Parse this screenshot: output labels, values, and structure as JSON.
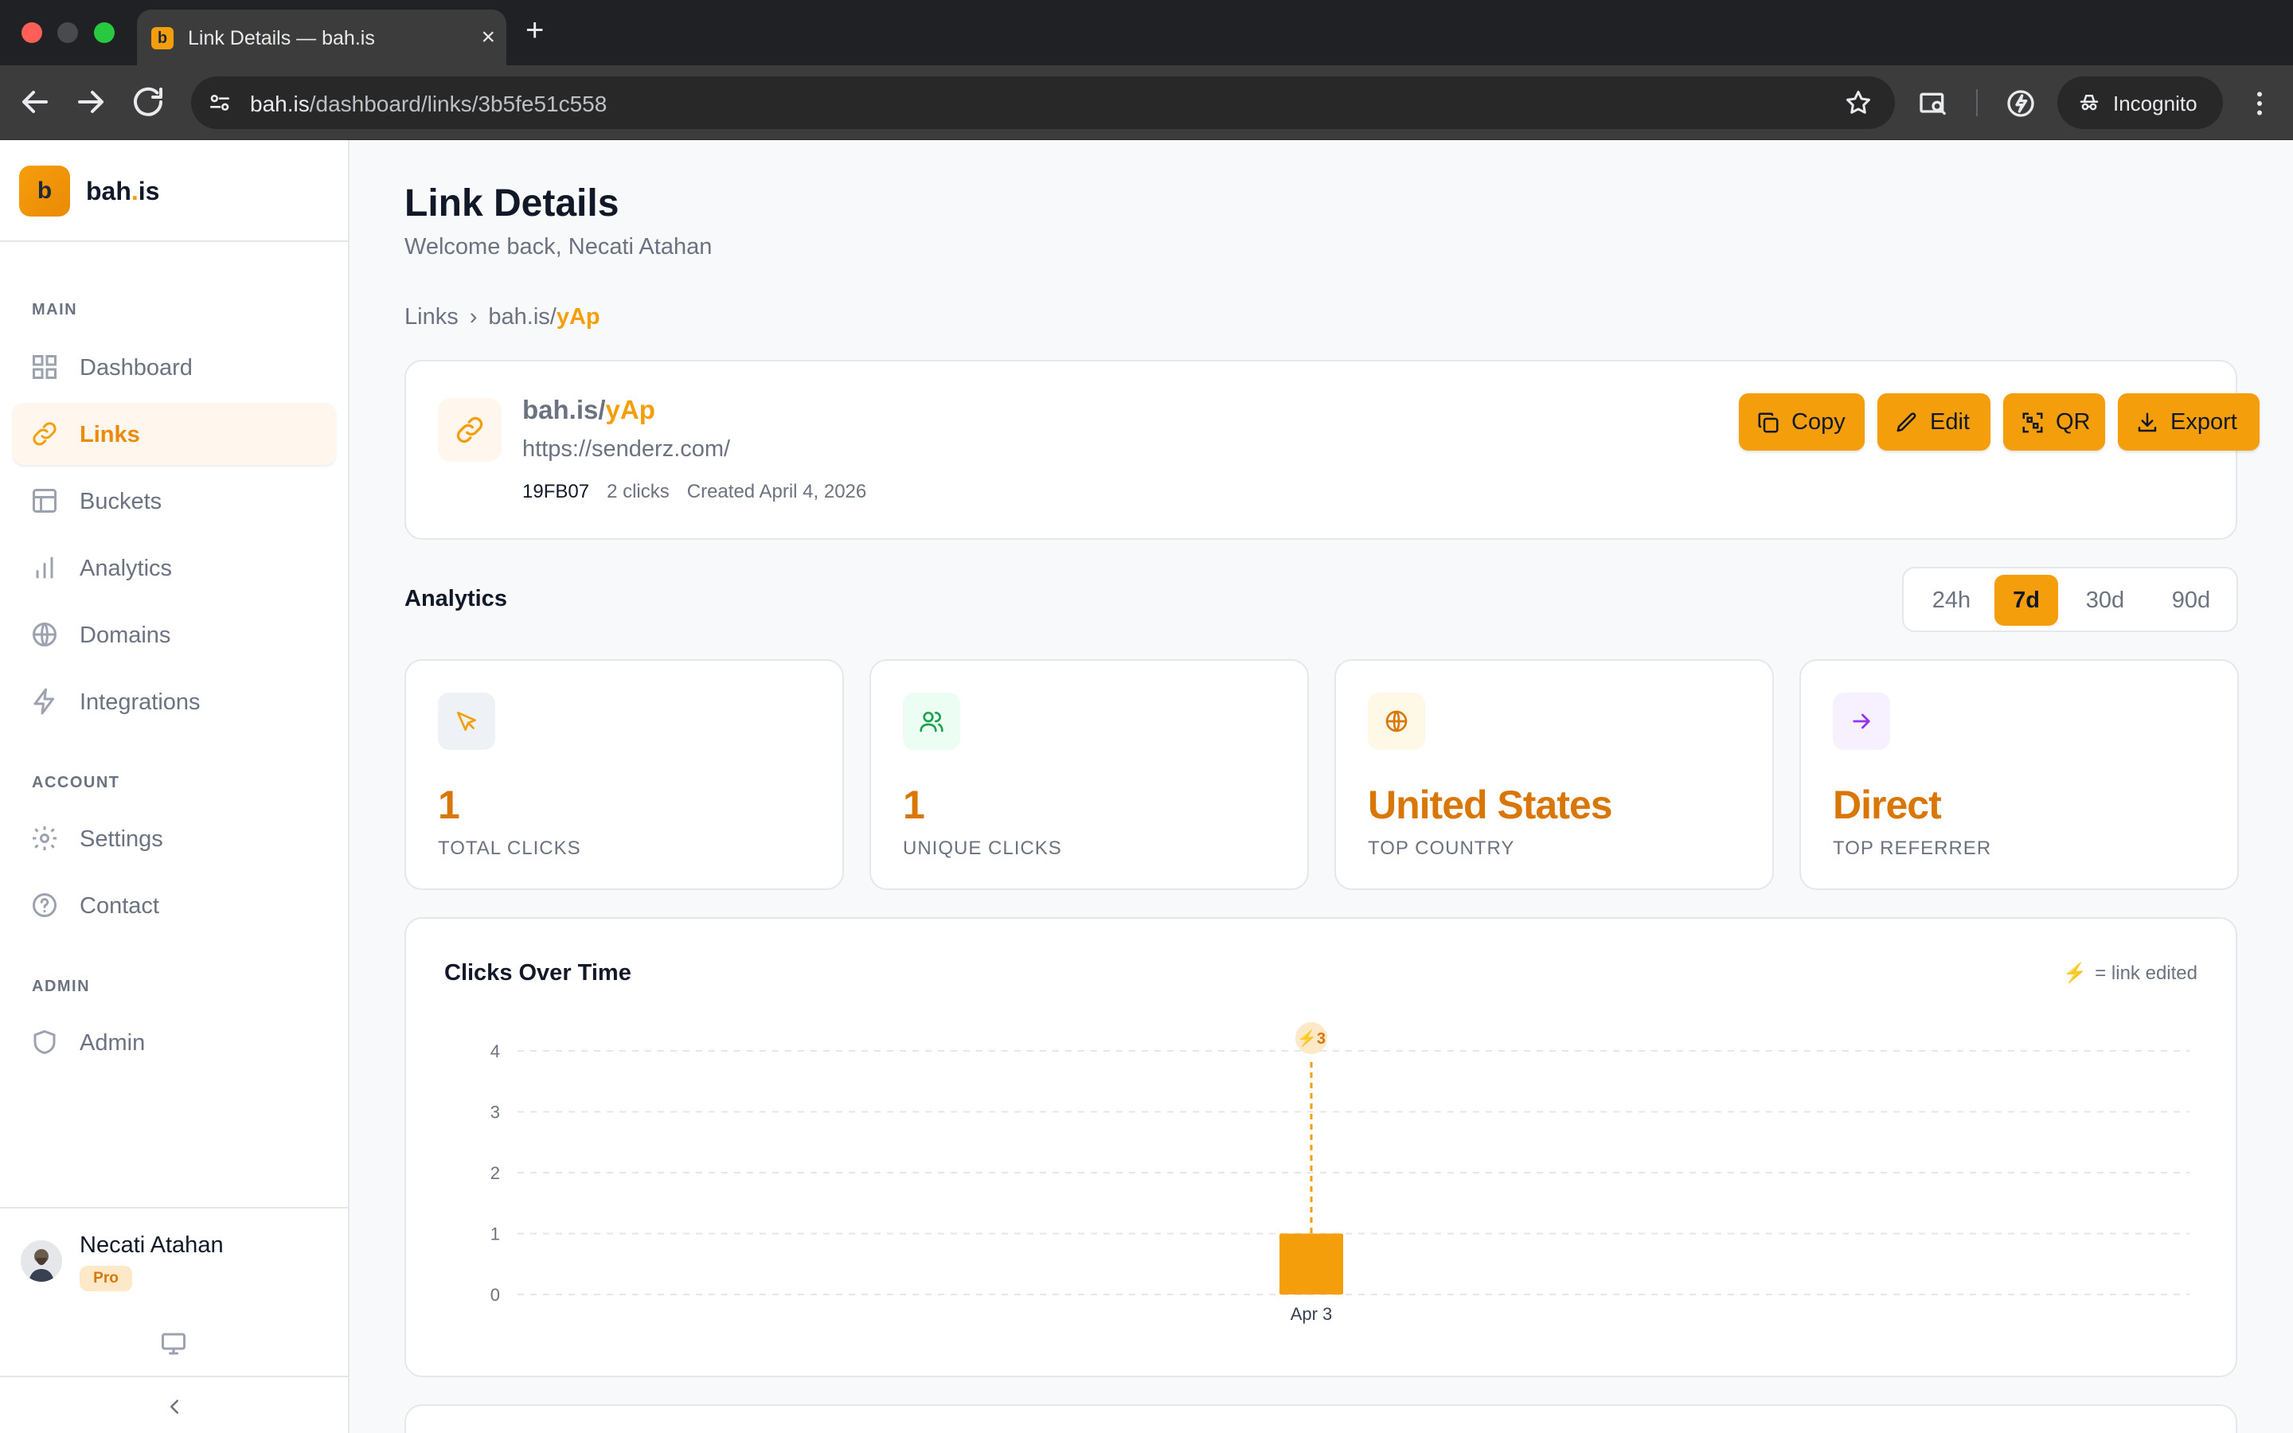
{
  "browser": {
    "tab_title": "Link Details — bah.is",
    "favicon_letter": "b",
    "url_host": "bah.is",
    "url_path": "/dashboard/links/3b5fe51c558",
    "incognito_label": "Incognito"
  },
  "sidebar": {
    "brand_letter": "b",
    "brand_name_a": "bah",
    "brand_name_dot": ".",
    "brand_name_b": "is",
    "sections": {
      "main": "MAIN",
      "account": "ACCOUNT",
      "admin": "ADMIN"
    },
    "items": [
      {
        "label": "Dashboard",
        "icon": "grid-icon"
      },
      {
        "label": "Links",
        "icon": "link-icon",
        "active": true
      },
      {
        "label": "Buckets",
        "icon": "layout-icon"
      },
      {
        "label": "Analytics",
        "icon": "bar-chart-icon"
      },
      {
        "label": "Domains",
        "icon": "globe-icon"
      },
      {
        "label": "Integrations",
        "icon": "zap-icon"
      },
      {
        "label": "Settings",
        "icon": "gear-icon"
      },
      {
        "label": "Contact",
        "icon": "help-circle-icon"
      },
      {
        "label": "Admin",
        "icon": "shield-icon"
      }
    ],
    "user": {
      "name": "Necati Atahan",
      "plan": "Pro"
    }
  },
  "page": {
    "title": "Link Details",
    "subtitle": "Welcome back, Necati Atahan",
    "breadcrumb": {
      "root": "Links",
      "separator": "›",
      "host": "bah.is/",
      "slug": "yAp"
    }
  },
  "link": {
    "short_host": "bah.is/",
    "short_slug": "yAp",
    "destination": "https://senderz.com/",
    "code": "19FB07",
    "clicks": "2 clicks",
    "created": "Created April 4, 2026",
    "actions": {
      "copy": "Copy",
      "edit": "Edit",
      "qr": "QR",
      "export": "Export"
    }
  },
  "analytics": {
    "title": "Analytics",
    "ranges": [
      "24h",
      "7d",
      "30d",
      "90d"
    ],
    "active_range": "7d",
    "stats": [
      {
        "value": "1",
        "label": "TOTAL CLICKS",
        "icon": "cursor-icon",
        "accent": "#f59e0b"
      },
      {
        "value": "1",
        "label": "UNIQUE CLICKS",
        "icon": "users-icon",
        "accent": "#16a34a"
      },
      {
        "value": "United States",
        "label": "TOP COUNTRY",
        "icon": "globe-icon",
        "accent": "#d97706"
      },
      {
        "value": "Direct",
        "label": "TOP REFERRER",
        "icon": "arrow-right-icon",
        "accent": "#9333ea"
      }
    ]
  },
  "chart": {
    "title": "Clicks Over Time",
    "legend_symbol": "⚡",
    "legend_text": "= link edited",
    "edit_marker": "⚡3"
  },
  "colors": {
    "accent": "#f59e0b",
    "accent_dark": "#d97706"
  },
  "chart_data": {
    "type": "bar",
    "categories": [
      "Apr 3"
    ],
    "values": [
      1
    ],
    "ylim": [
      0,
      4
    ],
    "yticks": [
      0,
      1,
      2,
      3,
      4
    ],
    "grid": true,
    "annotations": [
      {
        "category": "Apr 3",
        "label": "⚡3",
        "meaning": "link edited"
      }
    ]
  }
}
